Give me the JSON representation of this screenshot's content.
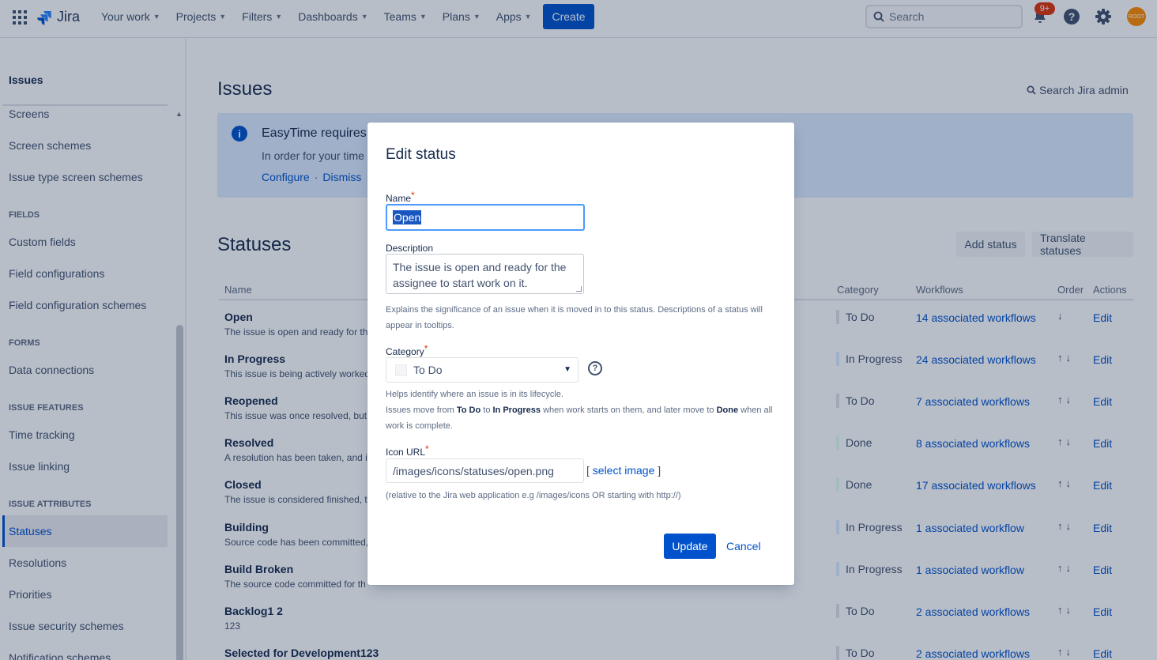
{
  "topnav": {
    "product": "Jira",
    "menu": [
      {
        "label": "Your work"
      },
      {
        "label": "Projects"
      },
      {
        "label": "Filters"
      },
      {
        "label": "Dashboards"
      },
      {
        "label": "Teams"
      },
      {
        "label": "Plans"
      },
      {
        "label": "Apps"
      }
    ],
    "create_label": "Create",
    "search_placeholder": "Search",
    "notifications_badge": "9+",
    "avatar_text": "ROOT",
    "icons": [
      "app-switcher-icon",
      "jira-logo-icon",
      "search-icon",
      "notifications-icon",
      "help-icon",
      "settings-icon"
    ]
  },
  "sidebar": {
    "title": "Issues",
    "items": [
      {
        "label": "Screens"
      },
      {
        "label": "Screen schemes"
      },
      {
        "label": "Issue type screen schemes"
      },
      {
        "label": "FIELDS",
        "section": true
      },
      {
        "label": "Custom fields"
      },
      {
        "label": "Field configurations"
      },
      {
        "label": "Field configuration schemes"
      },
      {
        "label": "FORMS",
        "section": true
      },
      {
        "label": "Data connections"
      },
      {
        "label": "ISSUE FEATURES",
        "section": true
      },
      {
        "label": "Time tracking"
      },
      {
        "label": "Issue linking"
      },
      {
        "label": "ISSUE ATTRIBUTES",
        "section": true
      },
      {
        "label": "Statuses",
        "active": true
      },
      {
        "label": "Resolutions"
      },
      {
        "label": "Priorities"
      },
      {
        "label": "Issue security schemes"
      },
      {
        "label": "Notification schemes"
      }
    ]
  },
  "main": {
    "title": "Issues",
    "search_admin": "Search Jira admin",
    "banner": {
      "title": "EasyTime requires",
      "body": "In order for your time",
      "configure": "Configure",
      "separator": "·",
      "dismiss": "Dismiss"
    },
    "section_title": "Statuses",
    "add_status": "Add status",
    "translate_statuses": "Translate statuses",
    "columns": {
      "name": "Name",
      "category": "Category",
      "workflows": "Workflows",
      "order": "Order",
      "actions": "Actions"
    },
    "rows": [
      {
        "name": "Open",
        "desc": "The issue is open and ready for the",
        "category": "To Do",
        "cat_color": "#dfe1e6",
        "workflows": "14 associated workflows",
        "order": "↓",
        "edit": "Edit"
      },
      {
        "name": "In Progress",
        "desc": "This issue is being actively worked",
        "category": "In Progress",
        "cat_color": "#deebff",
        "workflows": "24 associated workflows",
        "order": "↑↓",
        "edit": "Edit"
      },
      {
        "name": "Reopened",
        "desc": "This issue was once resolved, but t",
        "category": "To Do",
        "cat_color": "#dfe1e6",
        "workflows": "7 associated workflows",
        "order": "↑↓",
        "edit": "Edit"
      },
      {
        "name": "Resolved",
        "desc": "A resolution has been taken, and i",
        "category": "Done",
        "cat_color": "#e3fcef",
        "workflows": "8 associated workflows",
        "order": "↑↓",
        "edit": "Edit"
      },
      {
        "name": "Closed",
        "desc": "The issue is considered finished, th",
        "category": "Done",
        "cat_color": "#e3fcef",
        "workflows": "17 associated workflows",
        "order": "↑↓",
        "edit": "Edit"
      },
      {
        "name": "Building",
        "desc": "Source code has been committed,",
        "category": "In Progress",
        "cat_color": "#deebff",
        "workflows": "1 associated workflow",
        "order": "↑↓",
        "edit": "Edit"
      },
      {
        "name": "Build Broken",
        "desc": "The source code committed for th",
        "category": "In Progress",
        "cat_color": "#deebff",
        "workflows": "1 associated workflow",
        "order": "↑↓",
        "edit": "Edit"
      },
      {
        "name": "Backlog1 2",
        "desc": "123",
        "category": "To Do",
        "cat_color": "#dfe1e6",
        "workflows": "2 associated workflows",
        "order": "↑↓",
        "edit": "Edit"
      },
      {
        "name": "Selected for Development123",
        "desc": "",
        "category": "To Do",
        "cat_color": "#dfe1e6",
        "workflows": "2 associated workflows",
        "order": "↑↓",
        "edit": "Edit"
      }
    ]
  },
  "dialog": {
    "title": "Edit status",
    "name_label": "Name",
    "name_value": "Open",
    "required_mark": "*",
    "description_label": "Description",
    "description_value": "The issue is open and ready for the assignee to start work on it.",
    "description_help": "Explains the significance of an issue when it is moved in to this status. Descriptions of a status will appear in tooltips.",
    "category_label": "Category",
    "category_value": "To Do",
    "category_help_1": "Helps identify where an issue is in its lifecycle.",
    "category_help_2_a": "Issues move from ",
    "category_help_2_b": "To Do",
    "category_help_2_c": " to ",
    "category_help_2_d": "In Progress",
    "category_help_2_e": " when work starts on them, and later move to ",
    "category_help_2_f": "Done",
    "category_help_2_g": " when all work is complete.",
    "icon_url_label": "Icon URL",
    "icon_url_value": "/images/icons/statuses/open.png",
    "select_image_open": "[ ",
    "select_image": "select image",
    "select_image_close": " ]",
    "icon_url_help": "(relative to the Jira web application e.g /images/icons OR starting with http://)",
    "update_label": "Update",
    "cancel_label": "Cancel"
  }
}
